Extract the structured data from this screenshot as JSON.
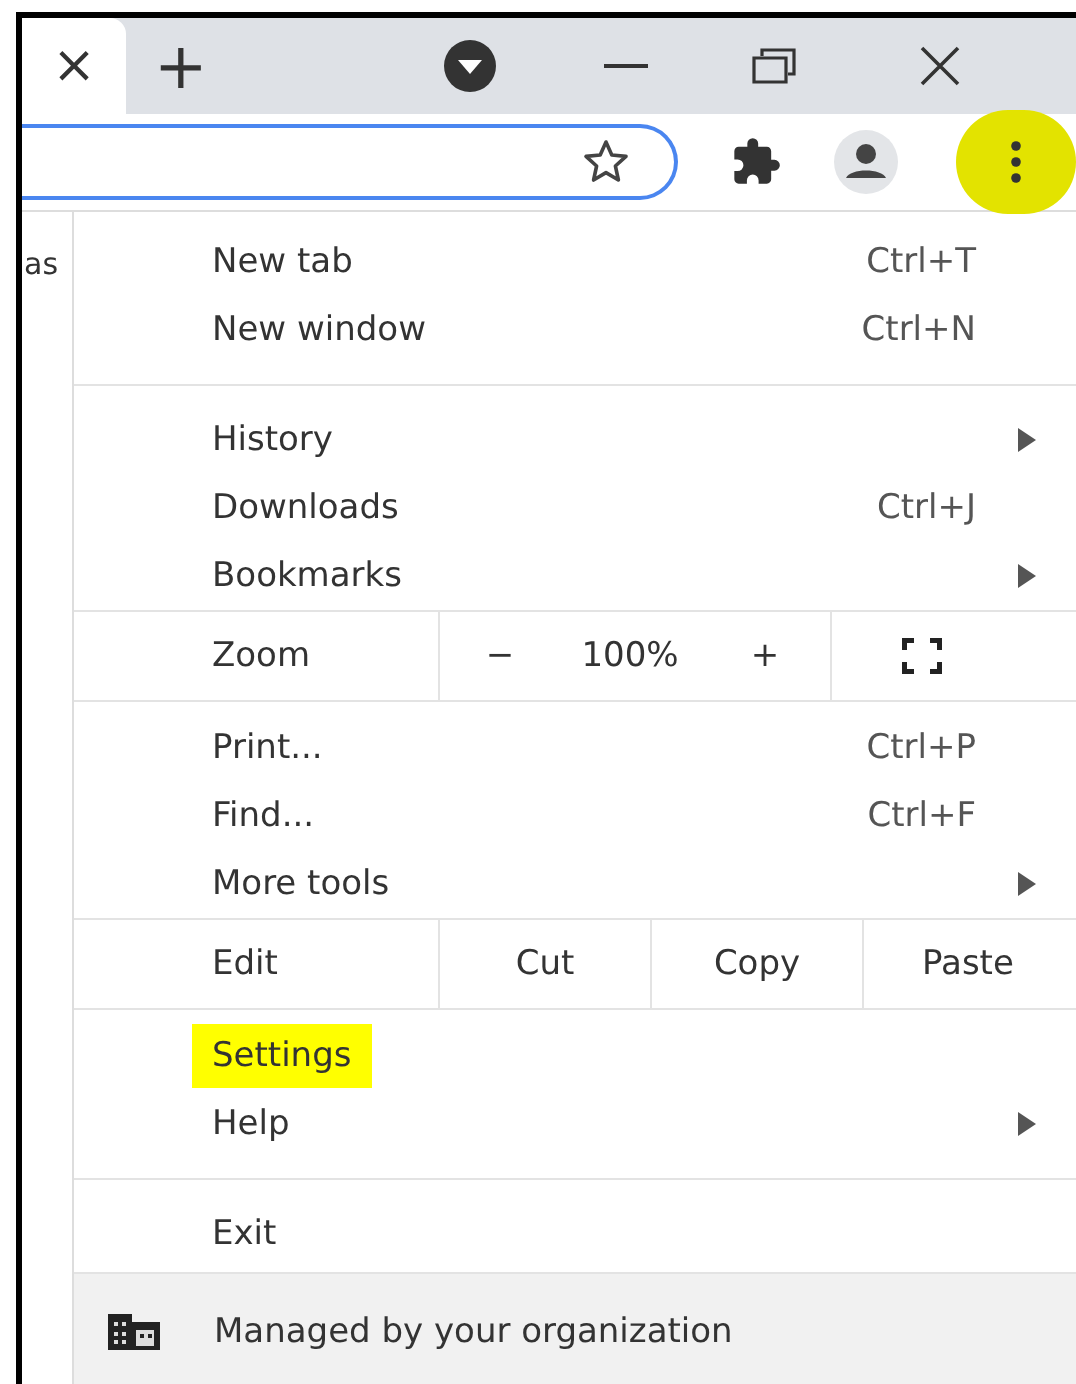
{
  "tab_strip": {
    "tab": {
      "close": "×",
      "selected": true
    },
    "new_tab": "+"
  },
  "toolbar": {
    "menu_button": {
      "highlighted": true
    }
  },
  "page": {
    "text": "as"
  },
  "menu": [
    {
      "kind": "item",
      "label": "New tab",
      "shortcut": "Ctrl+T",
      "submenu": false,
      "highlighted": false
    },
    {
      "kind": "item",
      "label": "New window",
      "shortcut": "Ctrl+N",
      "submenu": false,
      "highlighted": false
    },
    {
      "kind": "separator"
    },
    {
      "kind": "item",
      "label": "History",
      "submenu": true,
      "highlighted": false
    },
    {
      "kind": "item",
      "label": "Downloads",
      "shortcut": "Ctrl+J",
      "submenu": false,
      "highlighted": false
    },
    {
      "kind": "item",
      "label": "Bookmarks",
      "submenu": true,
      "highlighted": false
    },
    {
      "kind": "zoom",
      "label": "Zoom",
      "minus": "−",
      "value": "100%",
      "plus": "+"
    },
    {
      "kind": "item",
      "label": "Print...",
      "shortcut": "Ctrl+P",
      "submenu": false,
      "highlighted": false
    },
    {
      "kind": "item",
      "label": "Find...",
      "shortcut": "Ctrl+F",
      "submenu": false,
      "highlighted": false
    },
    {
      "kind": "item",
      "label": "More tools",
      "submenu": true,
      "highlighted": false
    },
    {
      "kind": "edit",
      "label": "Edit",
      "actions": [
        "Cut",
        "Copy",
        "Paste"
      ]
    },
    {
      "kind": "item",
      "label": "Settings",
      "submenu": false,
      "highlighted": true
    },
    {
      "kind": "item",
      "label": "Help",
      "submenu": true,
      "highlighted": false
    },
    {
      "kind": "separator"
    },
    {
      "kind": "item",
      "label": "Exit",
      "submenu": false,
      "highlighted": false
    },
    {
      "kind": "footer",
      "label": "Managed by your organization"
    }
  ]
}
